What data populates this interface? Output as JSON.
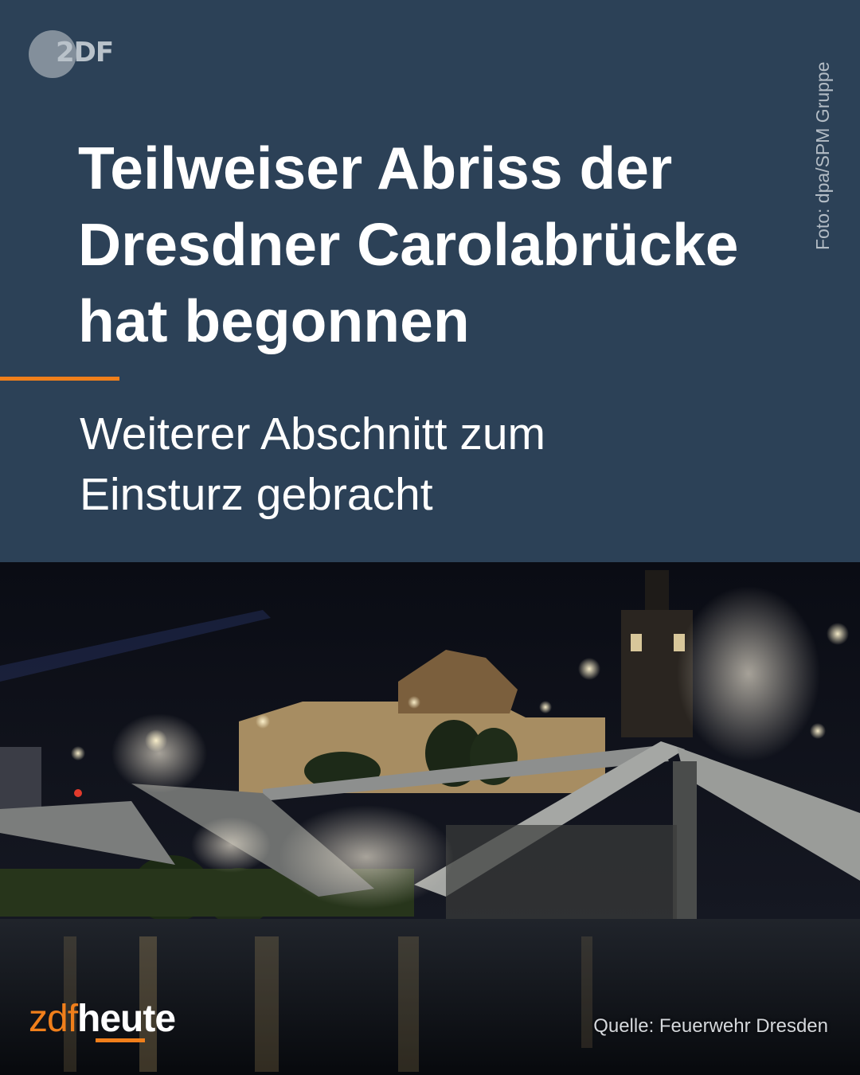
{
  "logo": {
    "text": "2DF",
    "icon": "zdf-logo-icon"
  },
  "headline": {
    "line1": "Teilweiser Abriss der",
    "line2": "Dresdner Carolabrücke",
    "line3": "hat begonnen"
  },
  "subheadline": {
    "line1": "Weiterer Abschnitt zum",
    "line2": "Einsturz gebracht"
  },
  "photo_credit": "Foto: dpa/SPM Gruppe",
  "brand": {
    "part1": "zdf",
    "part2": "heute"
  },
  "source": "Quelle: Feuerwehr Dresden",
  "colors": {
    "panel": "#2c4157",
    "accent": "#f07f1b",
    "text": "#ffffff"
  }
}
